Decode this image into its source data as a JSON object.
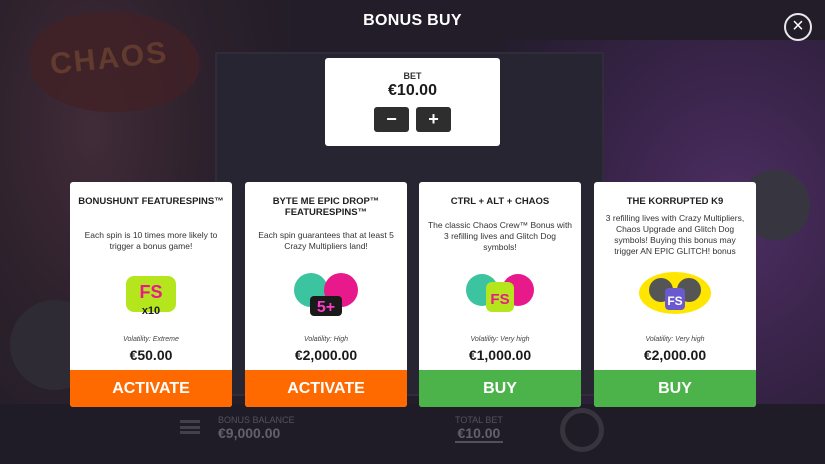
{
  "modal": {
    "title": "BONUS BUY",
    "close_icon": "close-icon"
  },
  "bet": {
    "label": "BET",
    "value": "€10.00",
    "minus_label": "−",
    "plus_label": "+"
  },
  "background": {
    "game_logo_text": "CHAOS",
    "balance_label": "BONUS BALANCE",
    "balance_value": "€9,000.00",
    "total_bet_label": "TOTAL BET",
    "total_bet_value": "€10.00"
  },
  "cards": [
    {
      "name": "BONUSHUNT FEATURESPINS™",
      "description": "Each spin is 10 times more likely to trigger a bonus game!",
      "volatility": "Volatility: Extreme",
      "price": "€50.00",
      "button": "ACTIVATE",
      "button_color": "#ff6a00",
      "art_label": "FS x10"
    },
    {
      "name": "BYTE ME EPIC DROP™ FEATURESPINS™",
      "description": "Each spin guarantees that at least 5 Crazy Multipliers land!",
      "volatility": "Volatility: High",
      "price": "€2,000.00",
      "button": "ACTIVATE",
      "button_color": "#ff6a00",
      "art_label": "5+"
    },
    {
      "name": "CTRL + ALT + CHAOS",
      "description": "The classic Chaos Crew™ Bonus with 3 refilling lives and Glitch Dog symbols!",
      "volatility": "Volatility: Very high",
      "price": "€1,000.00",
      "button": "BUY",
      "button_color": "#4cb34a",
      "art_label": "FS"
    },
    {
      "name": "THE KORRUPTED K9",
      "description": "3 refilling lives with Crazy Multipliers, Chaos Upgrade and Glitch Dog symbols! Buying this bonus may trigger AN EPIC GLITCH! bonus",
      "volatility": "Volatility: Very high",
      "price": "€2,000.00",
      "button": "BUY",
      "button_color": "#4cb34a",
      "art_label": "FS"
    }
  ]
}
